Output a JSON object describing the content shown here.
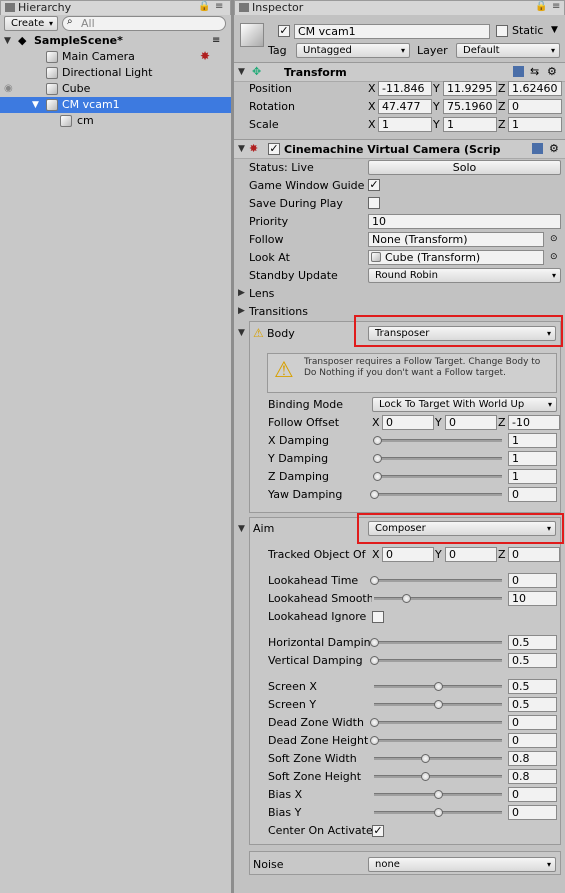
{
  "hierarchy": {
    "tab": "Hierarchy",
    "create": "Create",
    "search_placeholder": "All",
    "scene": "SampleScene*",
    "items": [
      "Main Camera",
      "Directional Light",
      "Cube",
      "CM vcam1",
      "cm"
    ]
  },
  "inspector": {
    "tab": "Inspector",
    "object_name": "CM vcam1",
    "static_label": "Static",
    "tag_label": "Tag",
    "tag_value": "Untagged",
    "layer_label": "Layer",
    "layer_value": "Default",
    "transform": {
      "title": "Transform",
      "position": "Position",
      "rotation": "Rotation",
      "scale": "Scale",
      "pos": [
        "-11.846",
        "11.9295",
        "1.62460"
      ],
      "rot": [
        "47.477",
        "75.1960",
        "0"
      ],
      "scl": [
        "1",
        "1",
        "1"
      ]
    },
    "vcam": {
      "title": "Cinemachine Virtual Camera (Scrip",
      "status": "Status: Live",
      "solo": "Solo",
      "game_window_guides": "Game Window Guide",
      "save_during_play": "Save During Play",
      "priority_label": "Priority",
      "priority": "10",
      "follow_label": "Follow",
      "follow": "None (Transform)",
      "lookat_label": "Look At",
      "lookat": "Cube (Transform)",
      "standby_label": "Standby Update",
      "standby": "Round Robin",
      "lens": "Lens",
      "transitions": "Transitions"
    },
    "body": {
      "title": "Body",
      "value": "Transposer",
      "warning": "Transposer requires a Follow Target.  Change Body to Do Nothing if you don't want a Follow target.",
      "binding_label": "Binding Mode",
      "binding": "Lock To Target With World Up",
      "offset_label": "Follow Offset",
      "offset": [
        "0",
        "0",
        "-10"
      ],
      "xd": "X Damping",
      "yd": "Y Damping",
      "zd": "Z Damping",
      "yawd": "Yaw Damping",
      "xd_v": "1",
      "yd_v": "1",
      "zd_v": "1",
      "yawd_v": "0"
    },
    "aim": {
      "title": "Aim",
      "value": "Composer",
      "tracked_label": "Tracked Object Of",
      "tracked": [
        "0",
        "0",
        "0"
      ],
      "rows": [
        {
          "label": "Lookahead Time",
          "value": "0",
          "frac": 0.0
        },
        {
          "label": "Lookahead Smooth",
          "value": "10",
          "frac": 0.25
        },
        {
          "label": "Horizontal Dampin",
          "value": "0.5",
          "frac": 0.0
        },
        {
          "label": "Vertical Damping",
          "value": "0.5",
          "frac": 0.0
        },
        {
          "label": "Screen X",
          "value": "0.5",
          "frac": 0.5
        },
        {
          "label": "Screen Y",
          "value": "0.5",
          "frac": 0.5
        },
        {
          "label": "Dead Zone Width",
          "value": "0",
          "frac": 0.0
        },
        {
          "label": "Dead Zone Height",
          "value": "0",
          "frac": 0.0
        },
        {
          "label": "Soft Zone Width",
          "value": "0.8",
          "frac": 0.4
        },
        {
          "label": "Soft Zone Height",
          "value": "0.8",
          "frac": 0.4
        },
        {
          "label": "Bias X",
          "value": "0",
          "frac": 0.5
        },
        {
          "label": "Bias Y",
          "value": "0",
          "frac": 0.5
        }
      ],
      "lookahead_ignore": "Lookahead Ignore",
      "center_on_activate": "Center On Activate"
    },
    "noise": {
      "title": "Noise",
      "value": "none"
    }
  }
}
